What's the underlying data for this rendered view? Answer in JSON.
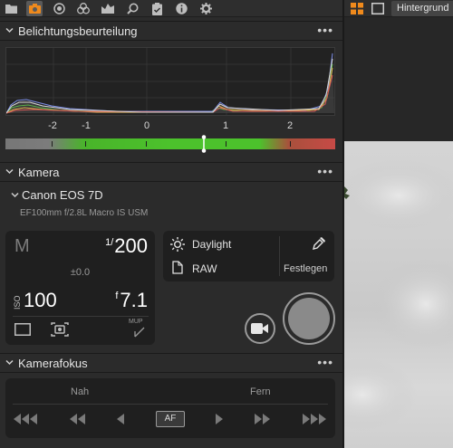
{
  "icons": {
    "toolbar": [
      "folder-icon",
      "camera-icon",
      "lens-icon",
      "color-circles-icon",
      "picture-style-icon",
      "search-icon",
      "clipboard-icon",
      "info-icon",
      "gear-icon"
    ],
    "active_tab": "camera-icon"
  },
  "sections": {
    "exposure": {
      "title": "Belichtungsbeurteilung",
      "menu": "•••"
    },
    "camera": {
      "title": "Kamera",
      "menu": "•••"
    },
    "focus": {
      "title": "Kamerafokus",
      "menu": "•••"
    }
  },
  "histogram": {
    "ev_labels": [
      "-2",
      "-1",
      "0",
      "1",
      "2"
    ],
    "ev_value": 0.8
  },
  "camera": {
    "model": "Canon EOS 7D",
    "lens": "EF100mm f/2.8L Macro IS USM",
    "mode": "M",
    "shutter_sup": "1/",
    "shutter_value": "200",
    "exposure_comp": "±0.0",
    "iso_label": "ISO",
    "iso_value": "100",
    "f_label": "f",
    "aperture_value": "7.1",
    "mup_label": "MUP",
    "white_balance": "Daylight",
    "image_quality": "RAW",
    "set_label": "Festlegen"
  },
  "focus": {
    "near_label": "Nah",
    "far_label": "Fern",
    "af_label": "AF"
  },
  "right_panel": {
    "tab_label": "Hintergrund"
  },
  "colors": {
    "accent_orange": "#f08a1c",
    "ev_green": "#4cc22c",
    "ev_red": "#c74a46"
  }
}
